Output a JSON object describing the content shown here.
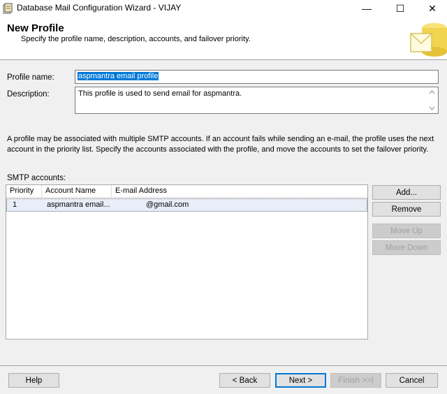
{
  "window": {
    "title": "Database Mail Configuration Wizard - VIJAY",
    "minimize_glyph": "—",
    "maximize_glyph": "☐",
    "close_glyph": "✕"
  },
  "header": {
    "title": "New Profile",
    "subtitle": "Specify the profile name, description, accounts, and failover priority."
  },
  "form": {
    "profile_name_label": "Profile name:",
    "profile_name_value": "aspmantra email profile",
    "description_label": "Description:",
    "description_value": "This profile is used to send email for aspmantra."
  },
  "info_text": "A profile may be associated with multiple SMTP accounts. If an account fails while sending an e-mail, the profile uses the next account in the priority list. Specify the accounts associated with the profile, and move the accounts to set the failover priority.",
  "smtp": {
    "label": "SMTP accounts:",
    "columns": [
      "Priority",
      "Account Name",
      "E-mail Address"
    ],
    "rows": [
      {
        "priority": "1",
        "account_name": "aspmantra email...",
        "email": "@gmail.com"
      }
    ],
    "buttons": {
      "add": "Add...",
      "remove": "Remove",
      "move_up": "Move Up",
      "move_down": "Move Down"
    }
  },
  "footer": {
    "help": "Help",
    "back": "< Back",
    "next": "Next >",
    "finish": "Finish >>|",
    "cancel": "Cancel"
  },
  "colors": {
    "selection": "#0078d7",
    "banner_bg": "#ffffff",
    "dialog_bg": "#f0f0f0"
  }
}
